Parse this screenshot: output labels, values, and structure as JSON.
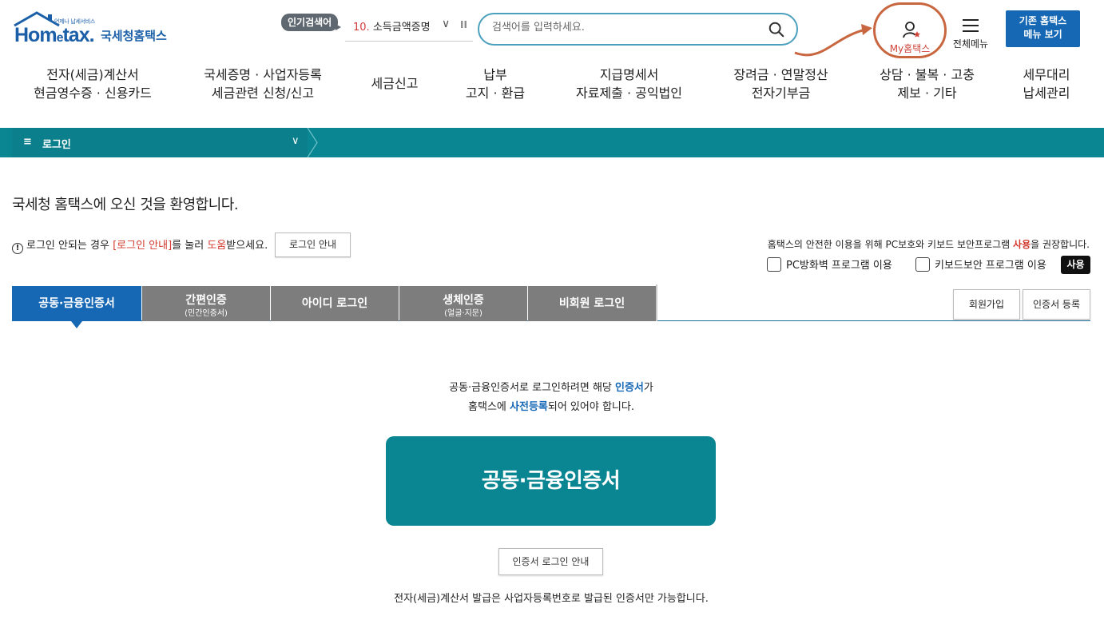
{
  "header": {
    "logo_sub": "언제나 납세서비스",
    "logo_main_a": "Hom",
    "logo_main_e": "e",
    "logo_main_b": "tax.",
    "logo_kor": "국세청홈택스",
    "popular_badge": "인기검색어",
    "popular_num": "10.",
    "popular_text": "소득금액증명",
    "search_placeholder": "검색어를 입력하세요.",
    "my_hometax": "My홈택스",
    "all_menu": "전체메뉴",
    "old_menu_line1": "기존 홈택스",
    "old_menu_line2": "메뉴 보기"
  },
  "nav": [
    {
      "line1": "전자(세금)계산서",
      "line2": "현금영수증 · 신용카드"
    },
    {
      "line1": "국세증명 · 사업자등록",
      "line2": "세금관련 신청/신고"
    },
    {
      "line1": "세금신고",
      "line2": ""
    },
    {
      "line1": "납부",
      "line2": "고지 · 환급"
    },
    {
      "line1": "지급명세서",
      "line2": "자료제출 · 공익법인"
    },
    {
      "line1": "장려금 · 연말정산",
      "line2": "전자기부금"
    },
    {
      "line1": "상담 · 불복 · 고충",
      "line2": "제보 · 기타"
    },
    {
      "line1": "세무대리",
      "line2": "납세관리"
    }
  ],
  "breadcrumb": {
    "menu_icon": "≡",
    "label": "로그인"
  },
  "welcome": "국세청 홈택스에 오신 것을 환영합니다.",
  "help": {
    "a": "로그인 안되는 경우 ",
    "b": "[로그인 안내]",
    "c": "를 눌러 ",
    "d": "도움",
    "e": "받으세요.",
    "button": "로그인 안내"
  },
  "recommend": {
    "a": "홈택스의 안전한 이용을 위해 PC보호와 키보드 보안프로그램 ",
    "b": "사용",
    "c": "을 권장합니다."
  },
  "checkboxes": [
    "PC방화벽 프로그램 이용",
    "키보드보안 프로그램 이용"
  ],
  "use_badge": "사용",
  "tabs": [
    {
      "label": "공동·금융인증서",
      "sub": ""
    },
    {
      "label": "간편인증",
      "sub": "(민간인증서)"
    },
    {
      "label": "아이디 로그인",
      "sub": ""
    },
    {
      "label": "생체인증",
      "sub": "(얼굴·지문)"
    },
    {
      "label": "비회원 로그인",
      "sub": ""
    }
  ],
  "side_buttons": [
    "회원가입",
    "인증서 등록"
  ],
  "desc": {
    "l1a": "공동·금융인증서로 로그인하려면 해당 ",
    "l1b": "인증서",
    "l1c": "가",
    "l2a": "홈택스에 ",
    "l2b": "사전등록",
    "l2c": "되어 있어야 합니다."
  },
  "big_button": "공동·금융인증서",
  "guide_button": "인증서 로그인 안내",
  "foot_note": "전자(세금)계산서 발급은 사업자등록번호로 발급된 인증서만 가능합니다.",
  "colors": {
    "teal": "#0a8693",
    "blue": "#1668b5",
    "red": "#d33b2f",
    "tab_gray": "#7d7d7d"
  }
}
